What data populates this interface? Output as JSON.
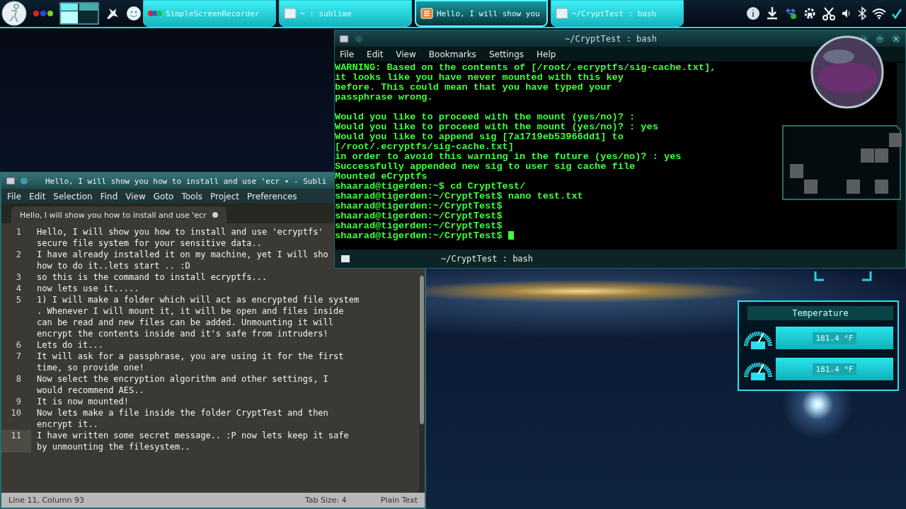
{
  "taskbar": {
    "tasks": [
      {
        "label": "SimpleScreenRecorder",
        "kind": "recorder",
        "selected": false
      },
      {
        "label": "~ : sublime",
        "kind": "window",
        "selected": false
      },
      {
        "label": "Hello, I will show you",
        "kind": "editor",
        "selected": true
      },
      {
        "label": "~/CryptTest : bash",
        "kind": "window",
        "selected": false
      }
    ]
  },
  "terminal": {
    "title": "~/CryptTest : bash",
    "menu": [
      "File",
      "Edit",
      "View",
      "Bookmarks",
      "Settings",
      "Help"
    ],
    "blocks": [
      [
        "WARNING: Based on the contents of [/root/.ecryptfs/sig-cache.txt],",
        "it looks like you have never mounted with this key",
        "before. This could mean that you have typed your",
        "passphrase wrong."
      ],
      [
        "Would you like to proceed with the mount (yes/no)? :",
        "Would you like to proceed with the mount (yes/no)? : yes",
        "Would you like to append sig [7a1719eb53966dd1] to",
        "[/root/.ecryptfs/sig-cache.txt]",
        "in order to avoid this warning in the future (yes/no)? : yes",
        "Successfully appended new sig to user sig cache file",
        "Mounted eCryptfs",
        "shaarad@tigerden:~$ cd CryptTest/",
        "shaarad@tigerden:~/CryptTest$ nano test.txt",
        "shaarad@tigerden:~/CryptTest$",
        "shaarad@tigerden:~/CryptTest$",
        "shaarad@tigerden:~/CryptTest$",
        "shaarad@tigerden:~/CryptTest$"
      ]
    ],
    "cursor_visible": true,
    "tab_label": "~/CryptTest : bash"
  },
  "editor": {
    "title": "Hello, I will show you how to install and use 'ecr • - Subli",
    "menu": [
      "File",
      "Edit",
      "Selection",
      "Find",
      "View",
      "Goto",
      "Tools",
      "Project",
      "Preferences"
    ],
    "tab": {
      "label": "Hello, I will show you how to install and use 'ecr",
      "modified": true
    },
    "lines": [
      {
        "number": "1",
        "current": false,
        "segments": [
          "Hello, I will show you how to install and use 'ecryptfs'",
          "secure file system for your sensitive data.."
        ]
      },
      {
        "number": "2",
        "current": false,
        "segments": [
          "I have already installed it on my machine, yet I will sho",
          "how to do it..lets start .. :D"
        ]
      },
      {
        "number": "3",
        "current": false,
        "segments": [
          "so this is the command to install ecryptfs..."
        ]
      },
      {
        "number": "4",
        "current": false,
        "segments": [
          "now lets use it....."
        ]
      },
      {
        "number": "5",
        "current": false,
        "segments": [
          "1) I will make a folder which will act as encrypted file system",
          ". Whenever I will mount it, it will be open and files inside",
          "can be read and new files can be added. Unmounting it will",
          "encrypt the contents inside and it's safe from intruders!"
        ]
      },
      {
        "number": "6",
        "current": false,
        "segments": [
          "Lets do it..."
        ]
      },
      {
        "number": "7",
        "current": false,
        "segments": [
          "It will ask for a passphrase, you are using it for the first",
          "time, so provide one!"
        ]
      },
      {
        "number": "8",
        "current": false,
        "segments": [
          "Now select the encryption algorithm and other settings, I",
          "would recommend AES.."
        ]
      },
      {
        "number": "9",
        "current": false,
        "segments": [
          "It is now mounted!"
        ]
      },
      {
        "number": "10",
        "current": false,
        "segments": [
          "Now lets make a file inside the folder CryptTest and then",
          "encrypt it.."
        ]
      },
      {
        "number": "11",
        "current": true,
        "segments": [
          "I have written some secret message.. :P now lets keep it safe",
          "by unmounting the filesystem.."
        ]
      }
    ],
    "status": {
      "position": "Line 11, Column 93",
      "tab_size": "Tab Size: 4",
      "syntax": "Plain Text"
    }
  },
  "temperature_widget": {
    "title": "Temperature",
    "readings": [
      "181.4 °F",
      "181.4 °F"
    ]
  }
}
